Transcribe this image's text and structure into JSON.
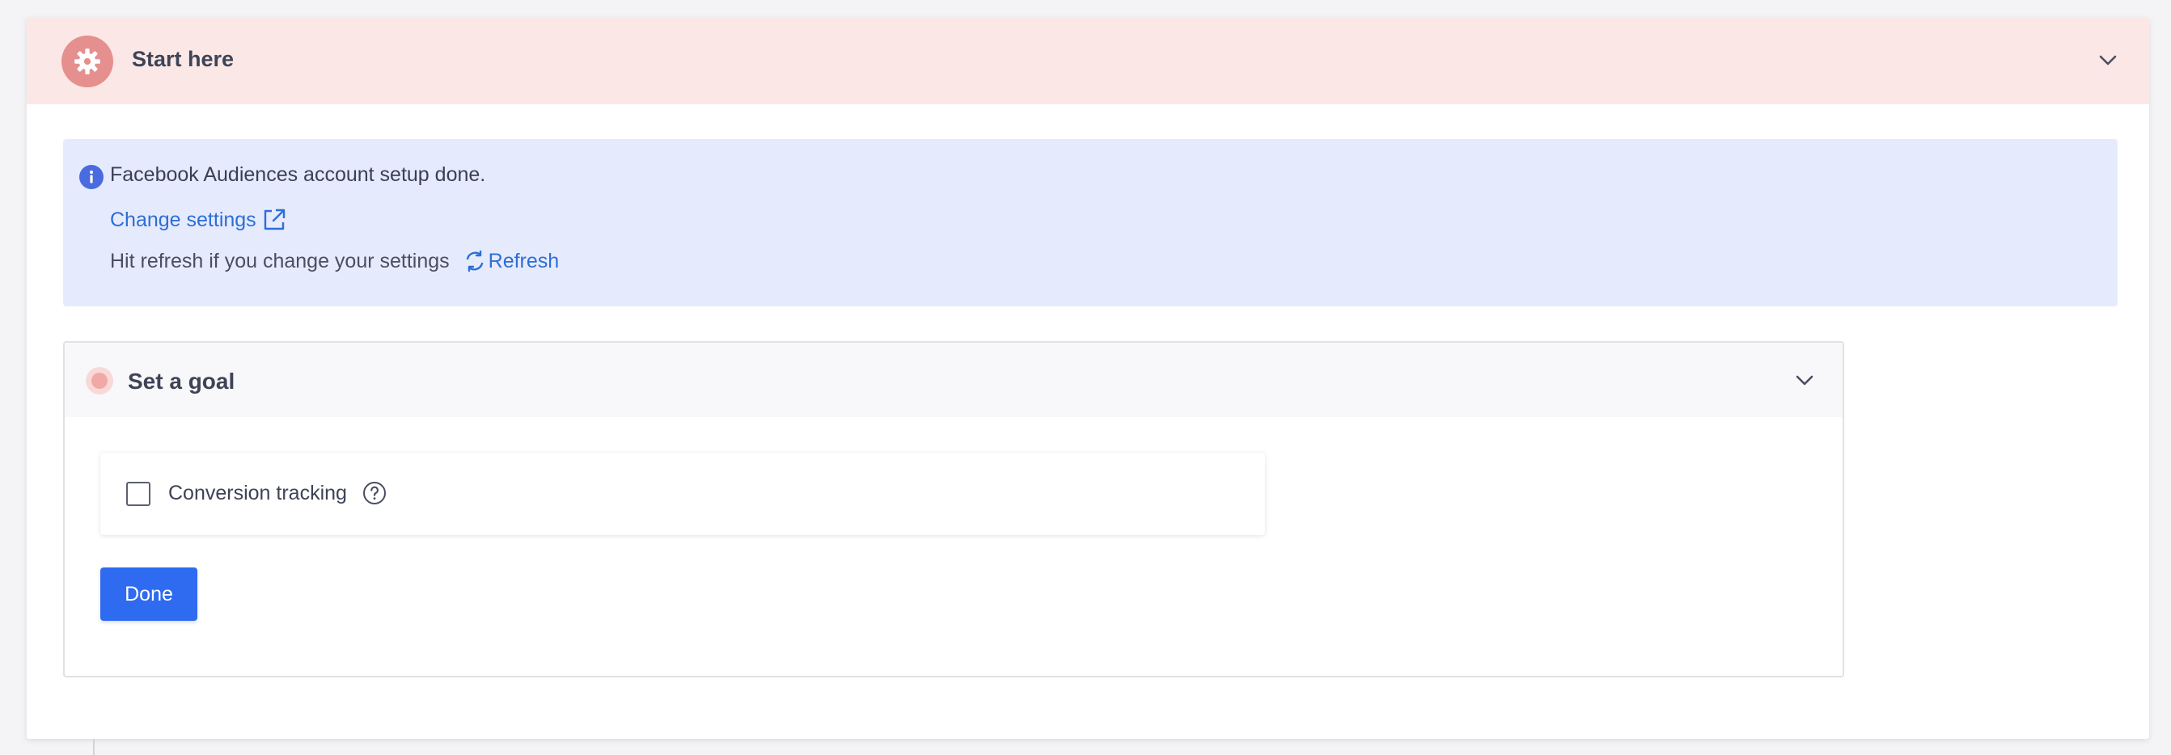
{
  "start_section": {
    "title": "Start here",
    "icon": "gear-icon",
    "accent": "#e58f8f"
  },
  "info": {
    "message": "Facebook Audiences account setup done.",
    "change_settings": "Change settings",
    "refresh_hint": "Hit refresh if you change your settings",
    "refresh_label": "Refresh"
  },
  "goal_section": {
    "title": "Set a goal",
    "conversion_label": "Conversion tracking",
    "conversion_checked": false,
    "done_label": "Done"
  },
  "colors": {
    "link": "#2b6fd6",
    "primary_button": "#2f6bf0",
    "info_bg": "#e6eafd",
    "header_bg": "#fbe8e6"
  }
}
